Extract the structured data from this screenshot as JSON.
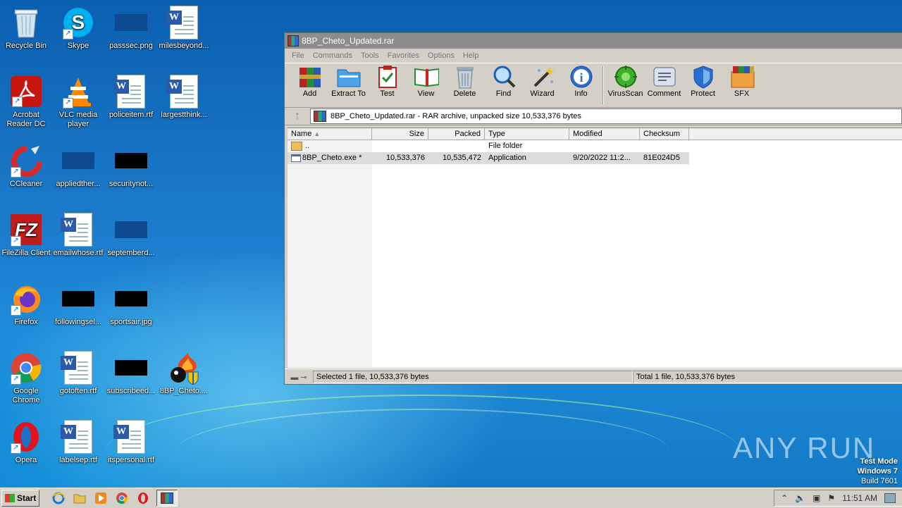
{
  "desktop": {
    "icons": [
      {
        "label": "Recycle Bin"
      },
      {
        "label": "Skype"
      },
      {
        "label": "passsec.png"
      },
      {
        "label": "milesbeyond..."
      },
      {
        "label": "Acrobat Reader DC"
      },
      {
        "label": "VLC media player"
      },
      {
        "label": "policeitem.rtf"
      },
      {
        "label": "largestthink..."
      },
      {
        "label": "CCleaner"
      },
      {
        "label": "appliedther..."
      },
      {
        "label": "securitynot..."
      },
      {
        "label": "FileZilla Client"
      },
      {
        "label": "emailwhose.rtf"
      },
      {
        "label": "septemberd..."
      },
      {
        "label": "Firefox"
      },
      {
        "label": "followingsel..."
      },
      {
        "label": "sportsair.jpg"
      },
      {
        "label": "Google Chrome"
      },
      {
        "label": "gotoften.rtf"
      },
      {
        "label": "subscribeed..."
      },
      {
        "label": "8BP_Cheto...."
      },
      {
        "label": "Opera"
      },
      {
        "label": "labelsep.rtf"
      },
      {
        "label": "itspersonal.rtf"
      }
    ]
  },
  "window": {
    "title": "8BP_Cheto_Updated.rar",
    "menu": [
      "File",
      "Commands",
      "Tools",
      "Favorites",
      "Options",
      "Help"
    ],
    "toolbar": [
      "Add",
      "Extract To",
      "Test",
      "View",
      "Delete",
      "Find",
      "Wizard",
      "Info",
      "VirusScan",
      "Comment",
      "Protect",
      "SFX"
    ],
    "address": "8BP_Cheto_Updated.rar - RAR archive, unpacked size 10,533,376 bytes",
    "columns": [
      "Name",
      "Size",
      "Packed",
      "Type",
      "Modified",
      "Checksum"
    ],
    "rows": [
      {
        "name": "..",
        "size": "",
        "packed": "",
        "type": "File folder",
        "modified": "",
        "checksum": ""
      },
      {
        "name": "8BP_Cheto.exe *",
        "size": "10,533,376",
        "packed": "10,535,472",
        "type": "Application",
        "modified": "9/20/2022 11:2...",
        "checksum": "81E024D5"
      }
    ],
    "status_left": "Selected 1 file, 10,533,376 bytes",
    "status_right": "Total 1 file, 10,533,376 bytes"
  },
  "watermark": {
    "text": "ANY RUN"
  },
  "testmode": {
    "line1": "Test Mode",
    "line2": "Windows 7",
    "line3": "Build 7601"
  },
  "taskbar": {
    "start": "Start",
    "clock": "11:51 AM"
  }
}
